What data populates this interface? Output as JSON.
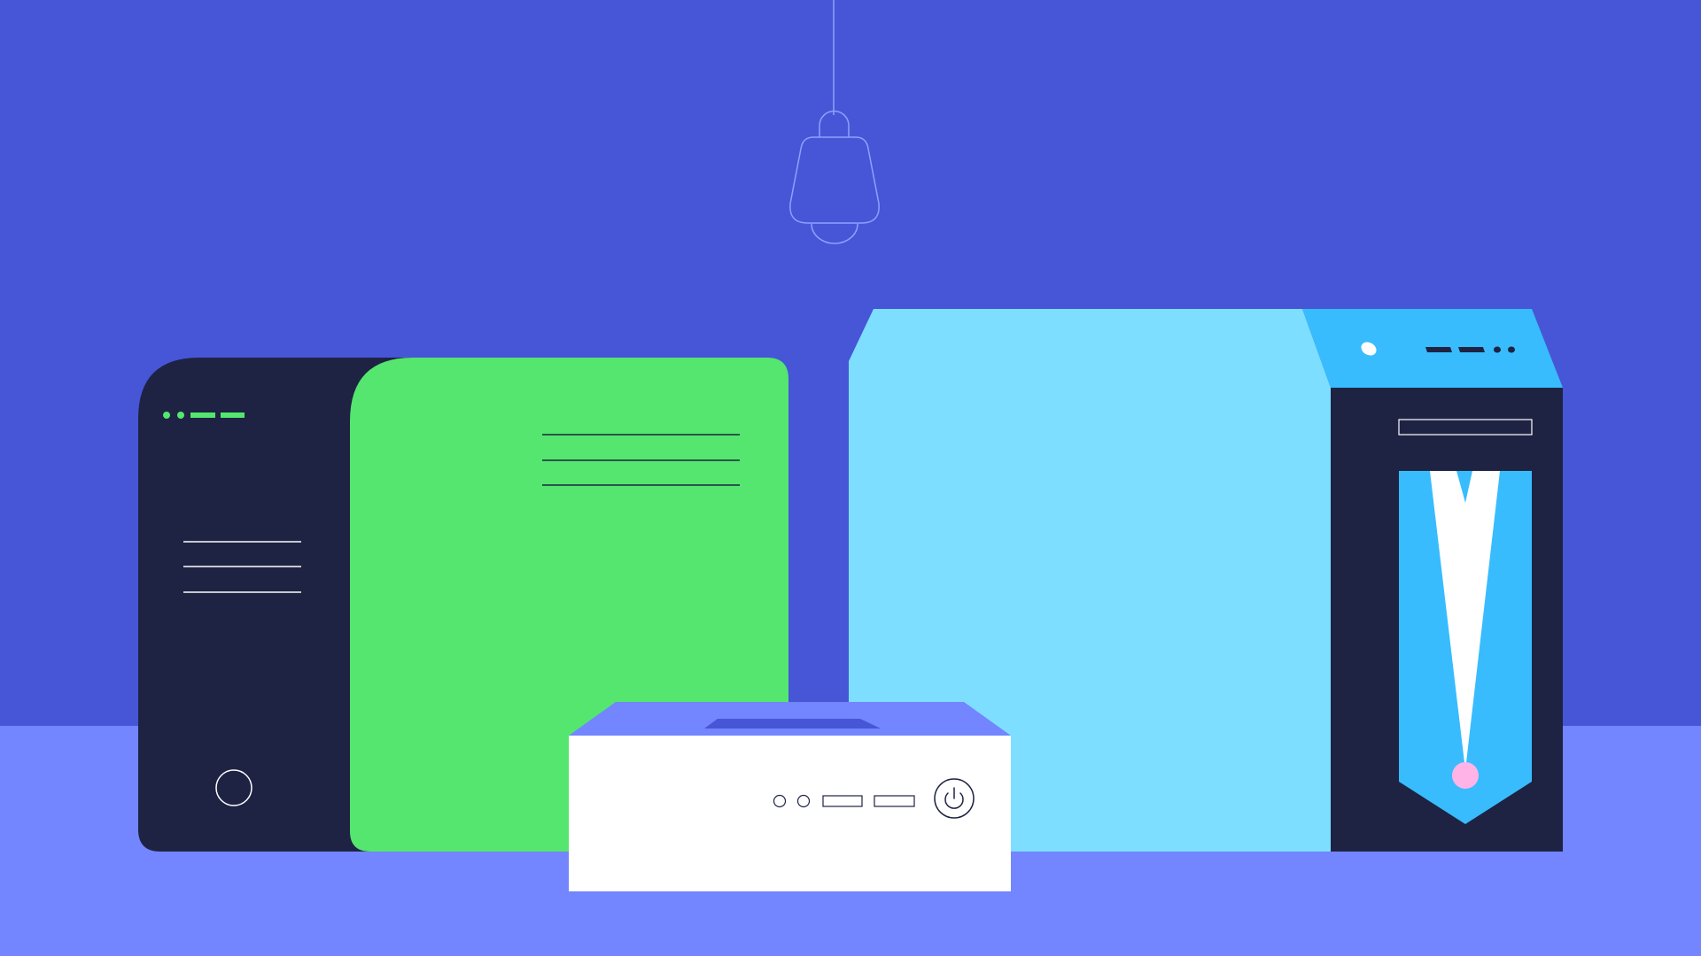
{
  "colors": {
    "wall": "#4656D6",
    "floor": "#7385FF",
    "dark": "#1E2343",
    "green": "#54E66E",
    "light_blue": "#7DDEFF",
    "sky_blue": "#38BCFE",
    "white": "#FFFFFF",
    "pink": "#FFB3E6",
    "lamp_stroke": "#8FA0FF"
  },
  "icons": [
    "pendant-lamp-icon",
    "power-icon"
  ]
}
